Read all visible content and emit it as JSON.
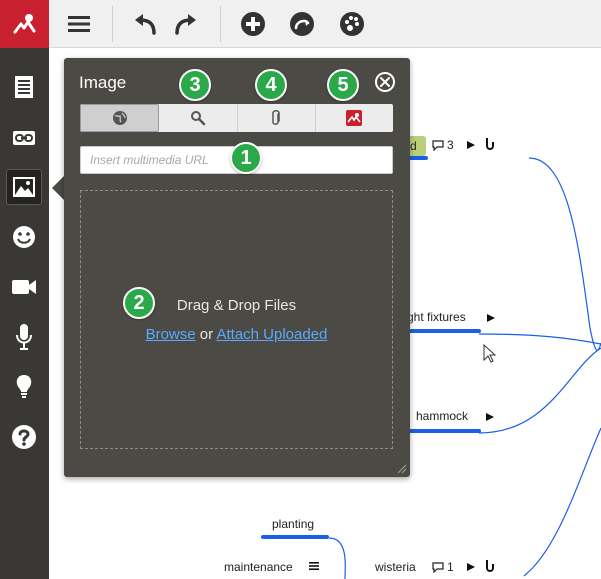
{
  "toolbar": {
    "buttons": [
      {
        "name": "menu-icon"
      },
      {
        "name": "undo-icon"
      },
      {
        "name": "redo-icon"
      },
      {
        "name": "add-node-icon"
      },
      {
        "name": "connect-icon"
      },
      {
        "name": "theme-palette-icon"
      }
    ]
  },
  "sidebar": {
    "items": [
      {
        "name": "notes-icon"
      },
      {
        "name": "link-icon"
      },
      {
        "name": "image-icon",
        "active": true
      },
      {
        "name": "emoji-icon"
      },
      {
        "name": "video-icon"
      },
      {
        "name": "microphone-icon"
      },
      {
        "name": "lightbulb-icon"
      },
      {
        "name": "help-icon"
      }
    ]
  },
  "popup": {
    "title": "Image",
    "tabs": [
      {
        "name": "web-url-tab",
        "icon": "globe-icon",
        "active": true
      },
      {
        "name": "search-tab",
        "icon": "search-icon"
      },
      {
        "name": "attachment-tab",
        "icon": "paperclip-icon"
      },
      {
        "name": "mindmeister-tab",
        "icon": "mindmeister-logo-icon"
      }
    ],
    "url_placeholder": "Insert multimedia URL",
    "drop_title": "Drag & Drop Files",
    "browse_label": "Browse",
    "or_label": "or",
    "attach_label": "Attach Uploaded"
  },
  "badges": [
    "1",
    "2",
    "3",
    "4",
    "5"
  ],
  "map": {
    "nodes": {
      "top_partial": "d",
      "top_comment_count": "3",
      "light_fixtures": "ght fixtures",
      "hammock": "hammock",
      "planting": "planting",
      "maintenance": "maintenance",
      "wisteria": "wisteria",
      "wisteria_comment_count": "1"
    }
  },
  "colors": {
    "brand_red": "#c8202f",
    "sidebar": "#3a3834",
    "popup": "#4c4a44",
    "link_blue": "#5aa9ff",
    "connector_blue": "#1a5fe6",
    "badge_green": "#2aa84a"
  }
}
